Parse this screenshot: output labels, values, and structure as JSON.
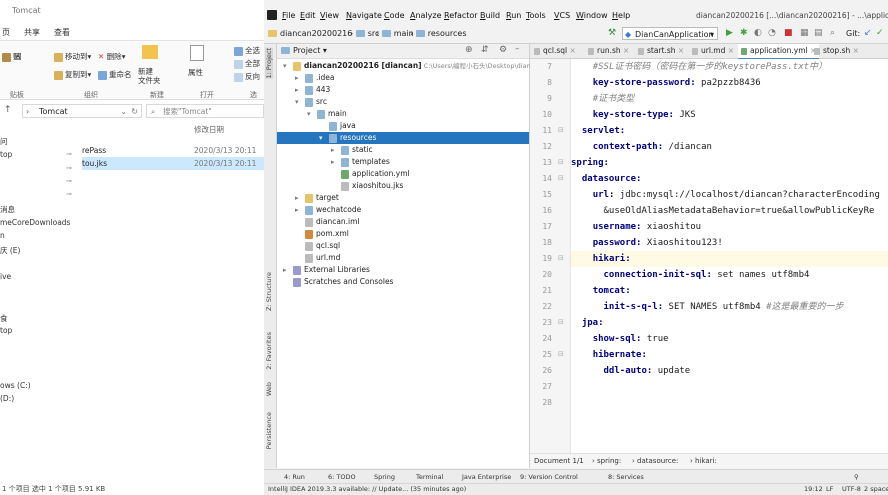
{
  "explorer": {
    "title": "Tomcat",
    "ribbon_tabs": [
      "页",
      "共享",
      "查看"
    ],
    "ribbon": {
      "move_to": "移动到",
      "delete": "删除",
      "copy_to": "复制到",
      "rename": "重命名",
      "new_folder": "新建\n文件夹",
      "properties": "属性",
      "select_all": "全选",
      "select_none": "全部",
      "invert": "反向",
      "group_org": "组织",
      "group_new": "新建",
      "group_open": "打开",
      "group_select": "选",
      "pin": "贴",
      "move_label": "固"
    },
    "address": "Tomcat",
    "search_placeholder": "搜索\"Tomcat\"",
    "nav_items": [
      "问",
      "top",
      "",
      "",
      "",
      "消息",
      "meCoreDownloads",
      "n",
      "庆 (E)",
      "",
      "ive",
      "",
      "",
      "食",
      "top",
      "",
      "",
      "",
      "ows (C:)",
      "(D:)"
    ],
    "column_headers": {
      "name": "",
      "date": "修改日期"
    },
    "files": [
      {
        "name": "rePass",
        "date": "2020/3/13 20:11",
        "selected": false
      },
      {
        "name": "tou.jks",
        "date": "2020/3/13 20:11",
        "selected": true
      }
    ],
    "status": "1 个项目   选中 1 个项目  5.91 KB"
  },
  "idea": {
    "menu": [
      "File",
      "Edit",
      "View",
      "Navigate",
      "Code",
      "Analyze",
      "Refactor",
      "Build",
      "Run",
      "Tools",
      "VCS",
      "Window",
      "Help"
    ],
    "window_title": "diancan20200216 [...\\diancan20200216] - ...\\application.yml",
    "breadcrumbs": [
      "diancan20200216",
      "src",
      "main",
      "resources"
    ],
    "run_config": "DianCanApplication",
    "git_label": "Git:",
    "left_tools": [
      "1: Project",
      "Z: Structure",
      "2: Favorites",
      "Web",
      "Persistence"
    ],
    "project_header": "Project",
    "tree": [
      {
        "label": "diancan20200216 [diancan]",
        "extra": "C:\\Users\\编程小石头\\Desktop\\diancan",
        "depth": 0,
        "arrow": "▾",
        "kind": "folder-y",
        "selected": false
      },
      {
        "label": ".idea",
        "extra": "",
        "depth": 1,
        "arrow": "▸",
        "kind": "folder",
        "selected": false
      },
      {
        "label": "443",
        "extra": "",
        "depth": 1,
        "arrow": "▸",
        "kind": "folder",
        "selected": false
      },
      {
        "label": "src",
        "extra": "",
        "depth": 1,
        "arrow": "▾",
        "kind": "folder",
        "selected": false
      },
      {
        "label": "main",
        "extra": "",
        "depth": 2,
        "arrow": "▾",
        "kind": "folder",
        "selected": false
      },
      {
        "label": "java",
        "extra": "",
        "depth": 3,
        "arrow": "",
        "kind": "folder",
        "selected": false
      },
      {
        "label": "resources",
        "extra": "",
        "depth": 3,
        "arrow": "▾",
        "kind": "folder",
        "selected": true
      },
      {
        "label": "static",
        "extra": "",
        "depth": 4,
        "arrow": "▸",
        "kind": "folder",
        "selected": false
      },
      {
        "label": "templates",
        "extra": "",
        "depth": 4,
        "arrow": "▸",
        "kind": "folder",
        "selected": false
      },
      {
        "label": "application.yml",
        "extra": "",
        "depth": 4,
        "arrow": "",
        "kind": "yml",
        "selected": false
      },
      {
        "label": "xiaoshitou.jks",
        "extra": "",
        "depth": 4,
        "arrow": "",
        "kind": "file",
        "selected": false
      },
      {
        "label": "target",
        "extra": "",
        "depth": 1,
        "arrow": "▸",
        "kind": "folder-y",
        "selected": false
      },
      {
        "label": "wechatcode",
        "extra": "",
        "depth": 1,
        "arrow": "▸",
        "kind": "folder",
        "selected": false
      },
      {
        "label": "diancan.iml",
        "extra": "",
        "depth": 1,
        "arrow": "",
        "kind": "file",
        "selected": false
      },
      {
        "label": "pom.xml",
        "extra": "",
        "depth": 1,
        "arrow": "",
        "kind": "xml",
        "selected": false
      },
      {
        "label": "qcl.sql",
        "extra": "",
        "depth": 1,
        "arrow": "",
        "kind": "file",
        "selected": false
      },
      {
        "label": "url.md",
        "extra": "",
        "depth": 1,
        "arrow": "",
        "kind": "file",
        "selected": false
      },
      {
        "label": "External Libraries",
        "extra": "",
        "depth": 0,
        "arrow": "▸",
        "kind": "lib",
        "selected": false
      },
      {
        "label": "Scratches and Consoles",
        "extra": "",
        "depth": 0,
        "arrow": "",
        "kind": "lib",
        "selected": false
      }
    ],
    "editor_tabs": [
      {
        "label": "qcl.sql",
        "active": false
      },
      {
        "label": "run.sh",
        "active": false
      },
      {
        "label": "start.sh",
        "active": false
      },
      {
        "label": "url.md",
        "active": false
      },
      {
        "label": "application.yml",
        "active": true
      },
      {
        "label": "stop.sh",
        "active": false
      }
    ],
    "code_lines": [
      {
        "n": "7",
        "indent": 4,
        "key": "",
        "val": "",
        "comment": "#SSL证书密码（密码在第一步的keystorePass.txt中）",
        "hl": false
      },
      {
        "n": "8",
        "indent": 4,
        "key": "key-store-password:",
        "val": " pa2pzzb8436",
        "comment": "",
        "hl": false
      },
      {
        "n": "9",
        "indent": 4,
        "key": "",
        "val": "",
        "comment": "#证书类型",
        "hl": false
      },
      {
        "n": "10",
        "indent": 4,
        "key": "key-store-type:",
        "val": " JKS",
        "comment": "",
        "hl": false
      },
      {
        "n": "11",
        "indent": 2,
        "key": "servlet:",
        "val": "",
        "comment": "",
        "hl": false
      },
      {
        "n": "12",
        "indent": 4,
        "key": "context-path:",
        "val": " /diancan",
        "comment": "",
        "hl": false
      },
      {
        "n": "13",
        "indent": 0,
        "key": "spring:",
        "val": "",
        "comment": "",
        "hl": false
      },
      {
        "n": "14",
        "indent": 2,
        "key": "datasource:",
        "val": "",
        "comment": "",
        "hl": false
      },
      {
        "n": "15",
        "indent": 4,
        "key": "url:",
        "val": " jdbc:mysql://localhost/diancan?characterEncoding",
        "comment": "",
        "hl": false
      },
      {
        "n": "16",
        "indent": 6,
        "key": "",
        "val": "&useOldAliasMetadataBehavior=true&allowPublicKeyRe",
        "comment": "",
        "hl": false
      },
      {
        "n": "17",
        "indent": 4,
        "key": "username:",
        "val": " xiaoshitou",
        "comment": "",
        "hl": false
      },
      {
        "n": "18",
        "indent": 4,
        "key": "password:",
        "val": " Xiaoshitou123!",
        "comment": "",
        "hl": false
      },
      {
        "n": "19",
        "indent": 4,
        "key": "hikari:",
        "val": "",
        "comment": "",
        "hl": true
      },
      {
        "n": "20",
        "indent": 6,
        "key": "connection-init-sql:",
        "val": " set names utf8mb4",
        "comment": "",
        "hl": false
      },
      {
        "n": "21",
        "indent": 4,
        "key": "tomcat:",
        "val": "",
        "comment": "",
        "hl": false
      },
      {
        "n": "22",
        "indent": 6,
        "key": "init-s-q-l:",
        "val": " SET NAMES utf8mb4 ",
        "comment": "#这是最重要的一步",
        "hl": false
      },
      {
        "n": "23",
        "indent": 2,
        "key": "jpa:",
        "val": "",
        "comment": "",
        "hl": false
      },
      {
        "n": "24",
        "indent": 4,
        "key": "show-sql:",
        "val": " true",
        "comment": "",
        "hl": false
      },
      {
        "n": "25",
        "indent": 4,
        "key": "hibernate:",
        "val": "",
        "comment": "",
        "hl": false
      },
      {
        "n": "26",
        "indent": 6,
        "key": "ddl-auto:",
        "val": " update",
        "comment": "",
        "hl": false
      },
      {
        "n": "27",
        "indent": 0,
        "key": "",
        "val": "",
        "comment": "",
        "hl": false
      },
      {
        "n": "28",
        "indent": 0,
        "key": "",
        "val": "",
        "comment": "",
        "hl": false
      }
    ],
    "editor_breadcrumb": [
      "Document 1/1",
      "spring:",
      "datasource:",
      "hikari:"
    ],
    "bottom_tools": [
      "4: Run",
      "6: TODO",
      "Spring",
      "Terminal",
      "Java Enterprise",
      "9: Version Control",
      "8: Services"
    ],
    "status_message": "IntelliJ IDEA 2019.3.3 available: // Update... (35 minutes ago)",
    "status_right": [
      "19:12",
      "LF",
      "UTF-8",
      "2 spaces"
    ],
    "colors": {
      "accent": "#2675bf",
      "key": "#000080",
      "comment": "#808080"
    }
  }
}
